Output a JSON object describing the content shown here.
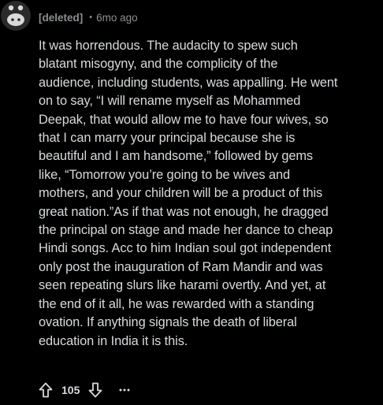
{
  "comment": {
    "author": "[deleted]",
    "separator": "•",
    "age": "6mo ago",
    "lines": [
      "It was horrendous. The audacity to spew such",
      "blatant misogyny, and the complicity of the",
      "audience, including students, was appalling. He went",
      "on to say, “I will rename myself as Mohammed",
      "Deepak, that would allow me to have four wives, so",
      "that I can marry your principal because she is",
      "beautiful and I am handsome,” followed by gems",
      "like, “Tomorrow you’re going to be wives and",
      "mothers, and your children will be a product of this",
      "great nation.”As if that was not enough, he dragged",
      "the principal on stage and made her dance to cheap",
      "Hindi songs. Acc to him Indian soul got independent",
      "only post the inauguration of Ram Mandir and was",
      "seen repeating slurs like harami overtly. And yet, at",
      "the end of it all, he was rewarded with a standing",
      "ovation. If anything signals the death of liberal",
      "education in India it is this."
    ],
    "score": "105",
    "icons": {
      "avatar": "deleted-user-avatar-icon",
      "upvote": "upvote-arrow-icon",
      "downvote": "downvote-arrow-icon",
      "more": "more-options-icon"
    }
  },
  "colors": {
    "background": "#000000",
    "body_text": "#d7dadc",
    "meta_text": "#8c8f91"
  }
}
